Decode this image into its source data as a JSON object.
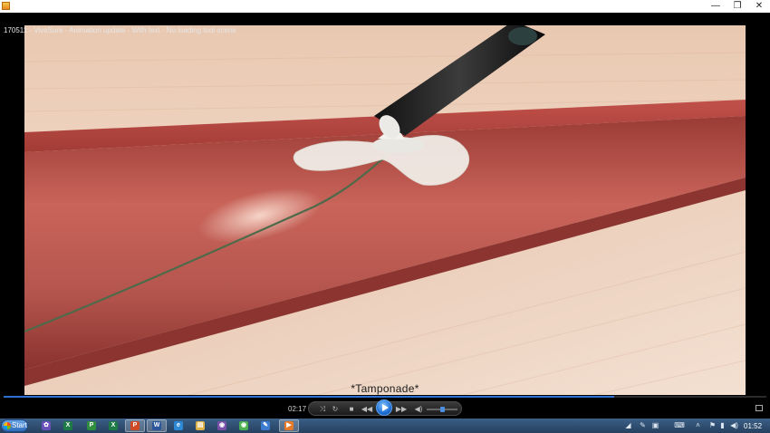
{
  "window": {
    "title": "170511 - VivaSure - Animation update - With text - No loading tool scene",
    "minimize_glyph": "—",
    "restore_glyph": "❐",
    "close_glyph": "✕"
  },
  "video": {
    "caption": "*Tamponade*"
  },
  "player": {
    "elapsed": "02:17",
    "progress": 0.8,
    "volume": 0.45,
    "buttons": {
      "shuffle": "⤨",
      "repeat": "↻",
      "stop": "■",
      "previous": "◀◀",
      "next": "▶▶",
      "mute": "◀)"
    }
  },
  "taskbar": {
    "start_label": "Start",
    "apps": [
      {
        "icon": "settings-app-icon",
        "glyph": "✿",
        "color": "#6a4fb8"
      },
      {
        "icon": "excel-icon",
        "glyph": "X",
        "color": "#1e7b45"
      },
      {
        "icon": "project-icon",
        "glyph": "P",
        "color": "#2f8f3e"
      },
      {
        "icon": "excel-icon",
        "glyph": "X",
        "color": "#1e7b45"
      },
      {
        "icon": "powerpoint-icon",
        "glyph": "P",
        "color": "#d04a25"
      },
      {
        "icon": "word-icon",
        "glyph": "W",
        "color": "#2b579a"
      },
      {
        "icon": "internet-explorer-icon",
        "glyph": "e",
        "color": "#2d88d6"
      },
      {
        "icon": "file-explorer-icon",
        "glyph": "▤",
        "color": "#e0b34a"
      },
      {
        "icon": "onenote-icon",
        "glyph": "◉",
        "color": "#7a4fa8"
      },
      {
        "icon": "chrome-icon",
        "glyph": "◉",
        "color": "#4caf50"
      },
      {
        "icon": "paint-icon",
        "glyph": "✎",
        "color": "#3b7bd0"
      },
      {
        "icon": "outlook-icon",
        "glyph": "O",
        "color": "#1f6fb5"
      },
      {
        "icon": "media-player-icon",
        "glyph": "▶",
        "color": "#e57a2a"
      }
    ],
    "tray": {
      "clock": "01:52"
    }
  }
}
